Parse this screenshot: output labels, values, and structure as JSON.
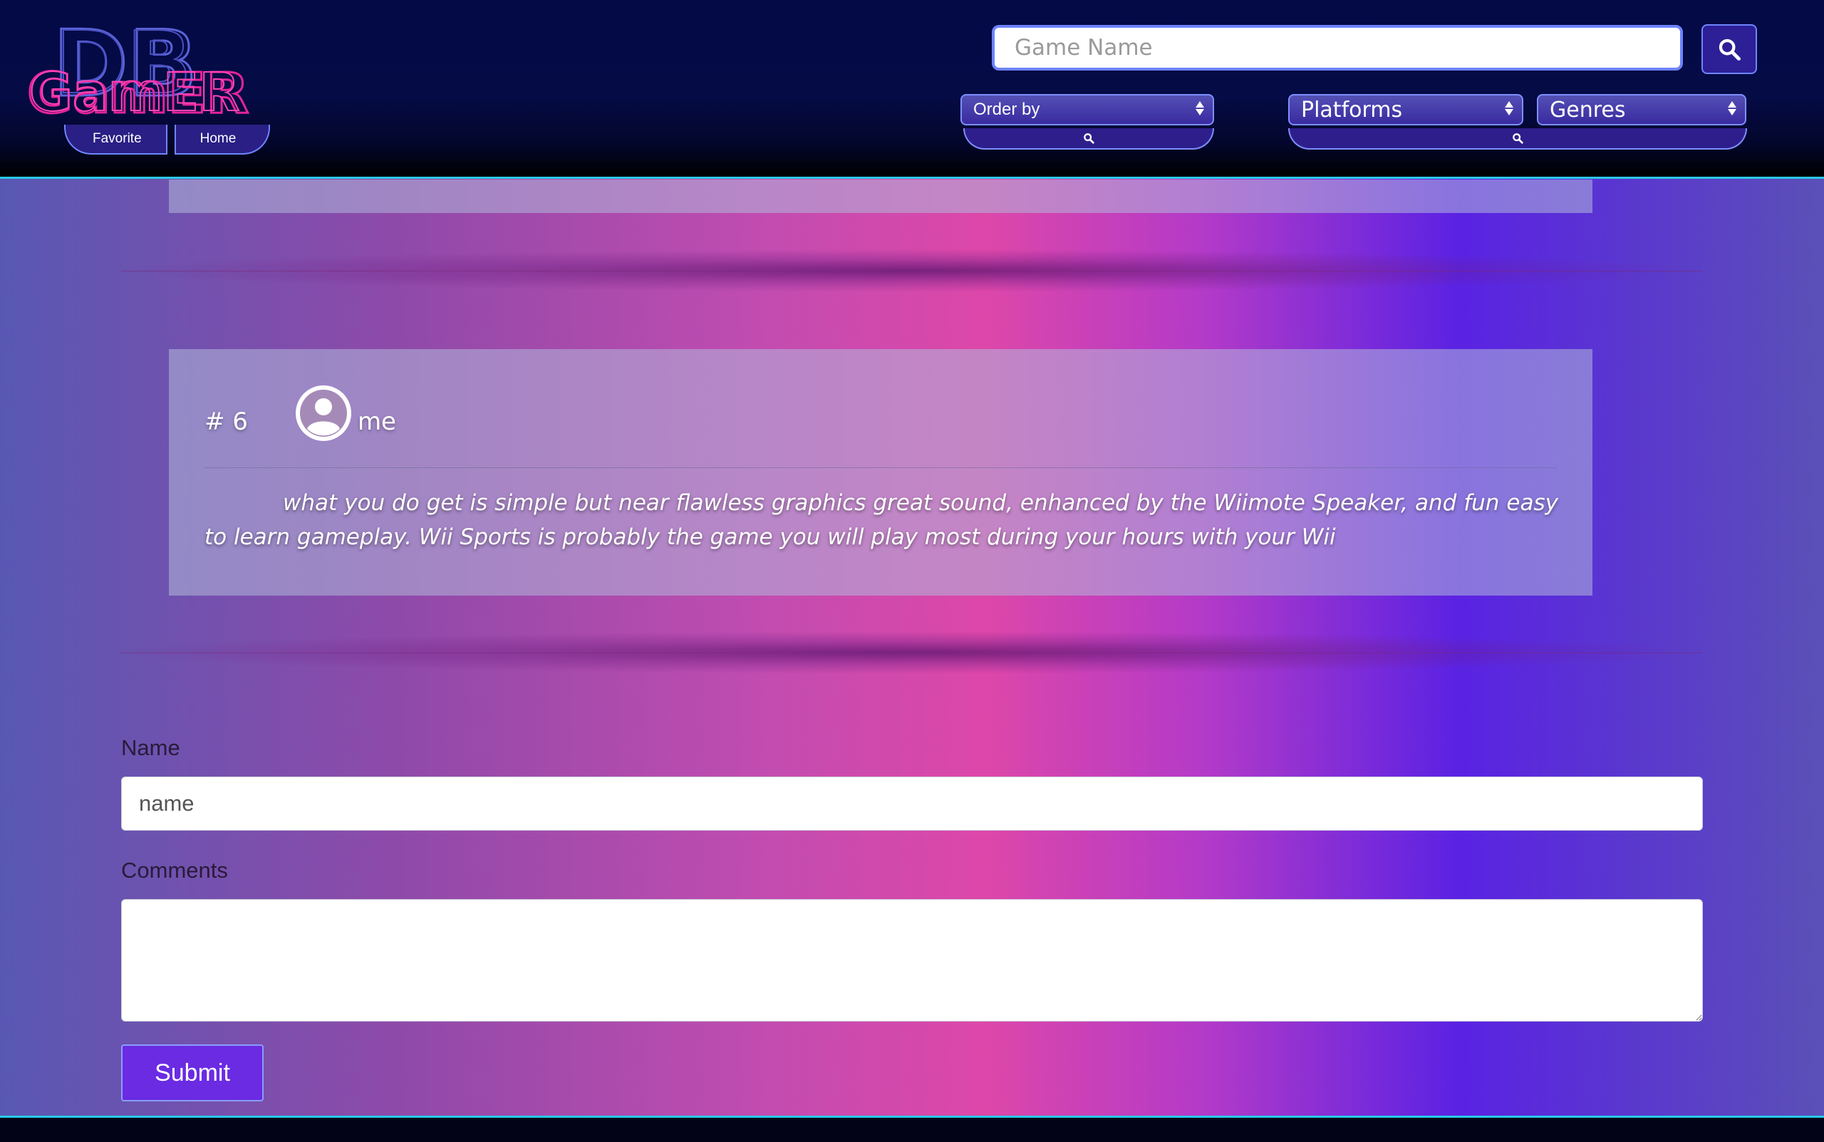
{
  "header": {
    "logo_text_top": "DB",
    "logo_text_bottom": "GamER",
    "nav": {
      "favorite_label": "Favorite",
      "home_label": "Home"
    },
    "search": {
      "placeholder": "Game Name",
      "value": ""
    },
    "filters": {
      "order_by": "Order by",
      "platforms": "Platforms",
      "genres": "Genres"
    }
  },
  "comment": {
    "rank": "# 6",
    "user": "me",
    "text": "what you do get is simple but near flawless graphics great sound, enhanced by the Wiimote Speaker, and fun easy to learn gameplay. Wii Sports is probably the game you will play most during your hours with your Wii"
  },
  "form": {
    "name_label": "Name",
    "name_placeholder": "name",
    "comments_label": "Comments",
    "comments_value": "",
    "submit_label": "Submit"
  },
  "colors": {
    "header_bg": "#030a46",
    "accent_border": "#6e83ff",
    "divider_cyan": "#29c9e8",
    "logo_blue": "#5b62d8",
    "logo_pink": "#e4249a",
    "submit_bg": "#6a2be3"
  },
  "icons": {
    "search": "search-icon",
    "avatar": "user-circle-icon",
    "select_arrows": "select-arrows-icon"
  }
}
